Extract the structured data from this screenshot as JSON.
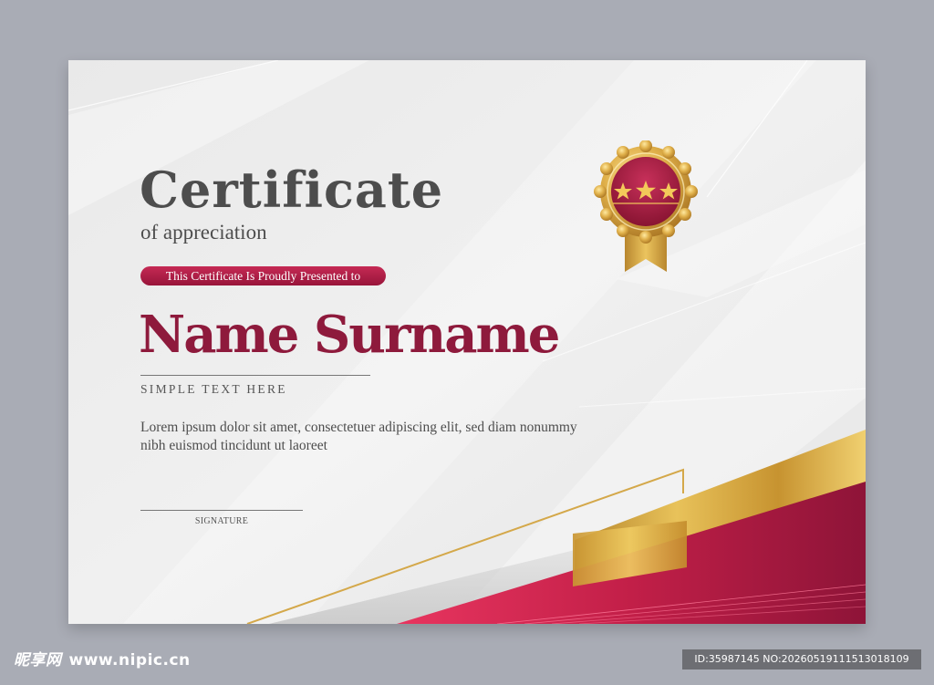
{
  "certificate": {
    "title": "Certificate",
    "subtitle": "of appreciation",
    "presented_label": "This Certificate Is Proudly Presented to",
    "recipient_name": "Name Surname",
    "tagline": "SIMPLE TEXT HERE",
    "body_text": "Lorem ipsum dolor sit amet, consectetuer adipiscing elit, sed diam nonummy nibh euismod tincidunt ut laoreet",
    "signature_label": "SIGNATURE",
    "seal_stars": 3
  },
  "colors": {
    "background": "#a9acb5",
    "paper": "#eeeeee",
    "crimson": "#8e1a3c",
    "gold": "#d9a640",
    "title_gray": "#4d4d4d"
  },
  "watermark": {
    "site_name": "昵享网",
    "site_url": "www.nipic.cn",
    "image_id": "ID:35987145 NO:20260519111513018109"
  }
}
